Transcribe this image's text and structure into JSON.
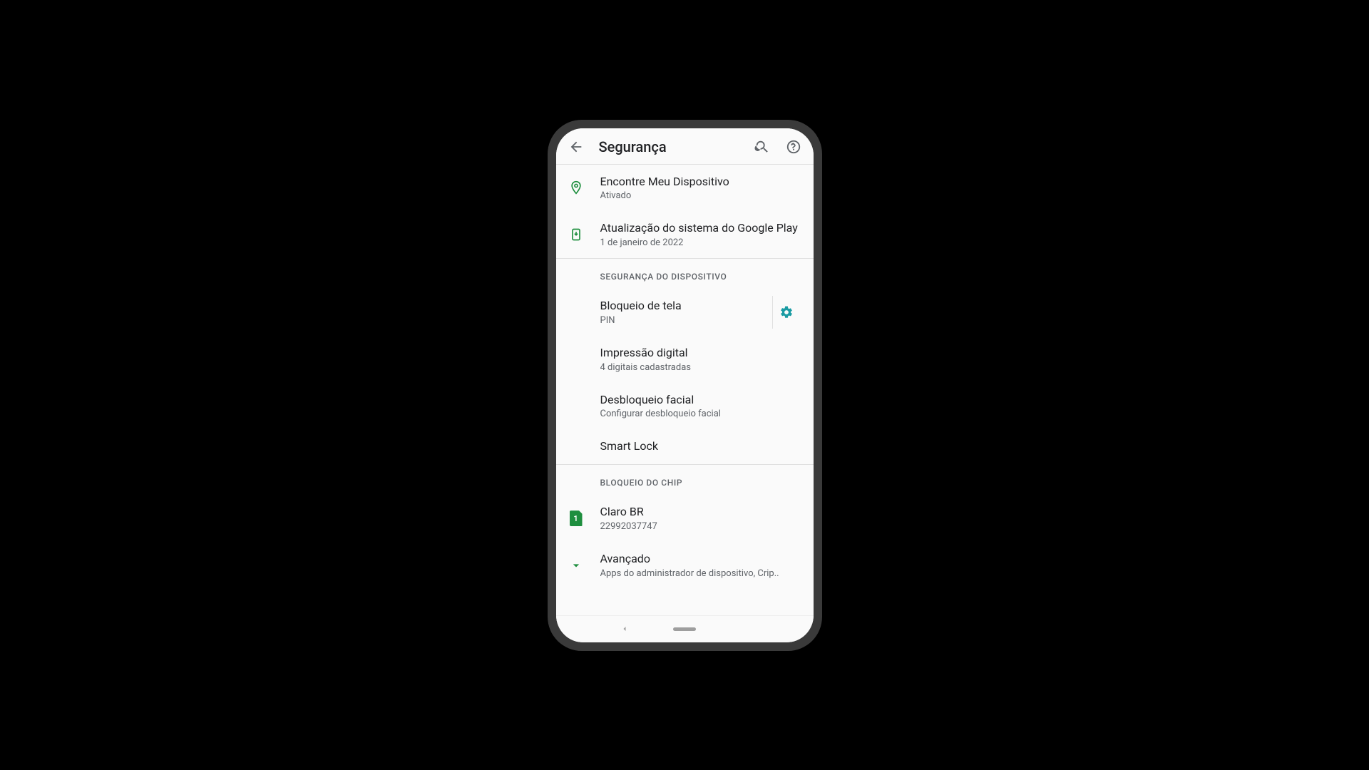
{
  "appBar": {
    "title": "Segurança"
  },
  "group1": {
    "findDevice": {
      "title": "Encontre Meu Dispositivo",
      "sub": "Ativado"
    },
    "playUpdate": {
      "title": "Atualização do sistema do Google Play",
      "sub": "1 de janeiro de 2022"
    }
  },
  "deviceSecurity": {
    "header": "SEGURANÇA DO DISPOSITIVO",
    "screenLock": {
      "title": "Bloqueio de tela",
      "sub": "PIN"
    },
    "fingerprint": {
      "title": "Impressão digital",
      "sub": "4 digitais cadastradas"
    },
    "faceUnlock": {
      "title": "Desbloqueio facial",
      "sub": "Configurar desbloqueio facial"
    },
    "smartLock": {
      "title": "Smart Lock"
    }
  },
  "simLock": {
    "header": "BLOQUEIO DO CHIP",
    "sim": {
      "badge": "1",
      "title": "Claro BR",
      "sub": "22992037747"
    }
  },
  "advanced": {
    "title": "Avançado",
    "sub": "Apps do administrador de dispositivo, Crip.."
  }
}
